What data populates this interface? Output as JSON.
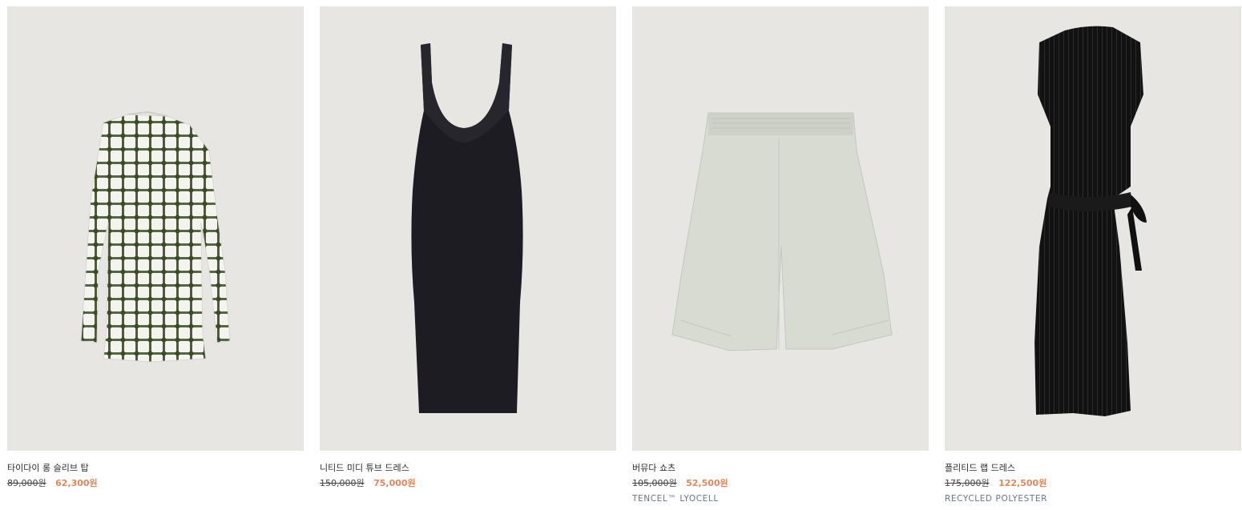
{
  "products": [
    {
      "name": "타이다이 롱 슬리브 탑",
      "original_price": "89,000원",
      "sale_price": "62,300원",
      "material": "",
      "image_icon": "tie-dye-top-image"
    },
    {
      "name": "니티드 미디 튜브 드레스",
      "original_price": "150,000원",
      "sale_price": "75,000원",
      "material": "",
      "image_icon": "knitted-dress-image"
    },
    {
      "name": "버뮤다 쇼츠",
      "original_price": "105,000원",
      "sale_price": "52,500원",
      "material": "TENCEL™ LYOCELL",
      "image_icon": "bermuda-shorts-image"
    },
    {
      "name": "플리티드 랩 드레스",
      "original_price": "175,000원",
      "sale_price": "122,500원",
      "material": "RECYCLED POLYESTER",
      "image_icon": "pleated-dress-image"
    }
  ],
  "colors": {
    "photo_background": "#e7e6e3",
    "sale_price": "#e0875d",
    "material_text": "#6a7788"
  }
}
